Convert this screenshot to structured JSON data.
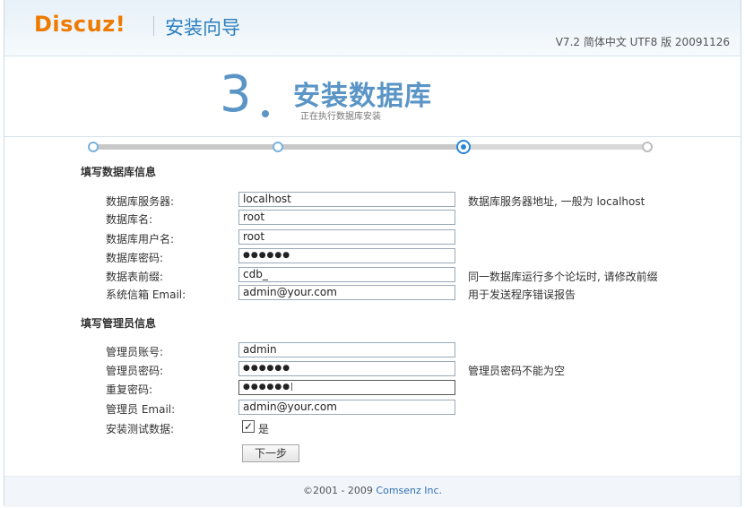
{
  "header": {
    "logo": "Discuz!",
    "wizard_title": "安装向导",
    "version": "V7.2 简体中文 UTF8 版 20091126"
  },
  "step": {
    "number": "3",
    "title": "安装数据库",
    "subtitle": "正在执行数据库安装"
  },
  "progress": {
    "total_steps": 4,
    "current_step": 3
  },
  "db_section": {
    "title": "填写数据库信息",
    "fields": [
      {
        "label": "数据库服务器:",
        "value": "localhost",
        "hint": "数据库服务器地址, 一般为 localhost"
      },
      {
        "label": "数据库名:",
        "value": "root",
        "hint": ""
      },
      {
        "label": "数据库用户名:",
        "value": "root",
        "hint": ""
      },
      {
        "label": "数据库密码:",
        "value": "●●●●●●",
        "hint": ""
      },
      {
        "label": "数据表前缀:",
        "value": "cdb_",
        "hint": "同一数据库运行多个论坛时, 请修改前缀"
      },
      {
        "label": "系统信箱 Email:",
        "value": "admin@your.com",
        "hint": "用于发送程序错误报告"
      }
    ]
  },
  "admin_section": {
    "title": "填写管理员信息",
    "fields": [
      {
        "label": "管理员账号:",
        "value": "admin",
        "hint": ""
      },
      {
        "label": "管理员密码:",
        "value": "●●●●●●",
        "hint": "管理员密码不能为空"
      },
      {
        "label": "重复密码:",
        "value": "●●●●●●|",
        "hint": ""
      },
      {
        "label": "管理员 Email:",
        "value": "admin@your.com",
        "hint": ""
      }
    ],
    "test_data": {
      "label": "安装测试数据:",
      "checkbox_label": "是",
      "checked_mark": "☑"
    }
  },
  "next_button": "下一步",
  "footer": {
    "prefix": "©2001 - 2009 ",
    "brand": "Comsenz Inc."
  },
  "colors": {
    "logo": "#ee7a00",
    "accent": "#2a86d6",
    "step": "#5a95c6"
  }
}
